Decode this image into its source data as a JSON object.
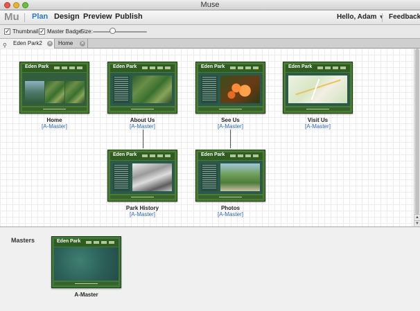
{
  "window": {
    "title": "Muse"
  },
  "menu": {
    "logo": "Mu",
    "items": [
      "Plan",
      "Design",
      "Preview",
      "Publish"
    ],
    "active": "Plan",
    "user": "Hello, Adam",
    "feedback": "Feedback"
  },
  "options": {
    "thumbnail_label": "Thumbnail",
    "thumbnail_checked": true,
    "master_badge_label": "Master Badge",
    "master_badge_checked": true,
    "size_label": "Size:",
    "size_value": 0.3
  },
  "tabs": [
    {
      "label": "Eden Park2",
      "active": true
    },
    {
      "label": "Home",
      "active": false
    }
  ],
  "site": {
    "brand": "Eden Park",
    "pages": [
      {
        "name": "Home",
        "master": "[A-Master]"
      },
      {
        "name": "About Us",
        "master": "[A-Master]"
      },
      {
        "name": "See Us",
        "master": "[A-Master]"
      },
      {
        "name": "Visit Us",
        "master": "[A-Master]"
      },
      {
        "name": "Park History",
        "master": "[A-Master]"
      },
      {
        "name": "Photos",
        "master": "[A-Master]"
      }
    ]
  },
  "masters": {
    "title": "Masters",
    "items": [
      {
        "name": "A-Master"
      }
    ]
  },
  "colors": {
    "accent": "#2a78c8",
    "link": "#2a63b8",
    "page_frame": "#4a7d32"
  }
}
